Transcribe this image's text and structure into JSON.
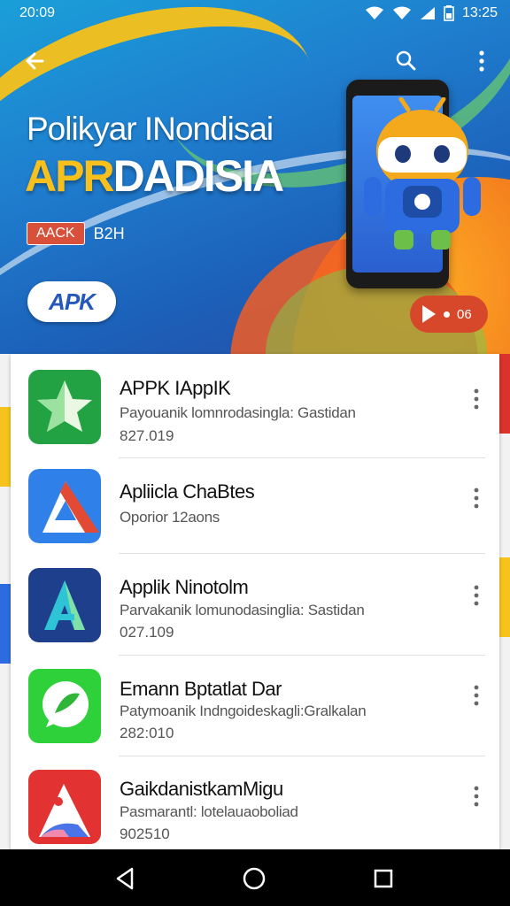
{
  "status": {
    "left": "20:09",
    "right": "13:25"
  },
  "hero": {
    "title_line1": "Polikyar INondisai",
    "title_line2_a": "APR",
    "title_line2_b": "DADISIA",
    "tag_chip": "AACK",
    "tag_text": "B2H",
    "logo_text": "APK",
    "pill_text": "06"
  },
  "apps": [
    {
      "title": "APPK IAppIK",
      "subtitle": "Payouanik lomnrodasingla: Gastidan",
      "meta": "827.019",
      "icon": "green-star-icon"
    },
    {
      "title": "Apliicla ChaBtes",
      "subtitle": "Oporior  12aons",
      "meta": "",
      "icon": "red-blue-triangle-icon"
    },
    {
      "title": "Applik Ninotolm",
      "subtitle": "Parvakanik lomunodasinglia: Sastidan",
      "meta": "027.109",
      "icon": "navy-a-icon"
    },
    {
      "title": "Emann Bptatlat Dar",
      "subtitle": "Patymoanik Indngoideskagli:Gralkalan",
      "meta": "282:010",
      "icon": "green-chat-icon"
    },
    {
      "title": "GaikdanistkamMigu",
      "subtitle": "Pasmarantl: lotelauaoboliad",
      "meta": "902510",
      "icon": "red-a-icon"
    }
  ],
  "colors": {
    "accent": "#d7482b",
    "hero_blue": "#1f7fcf",
    "brand_yellow": "#f8c01d"
  }
}
